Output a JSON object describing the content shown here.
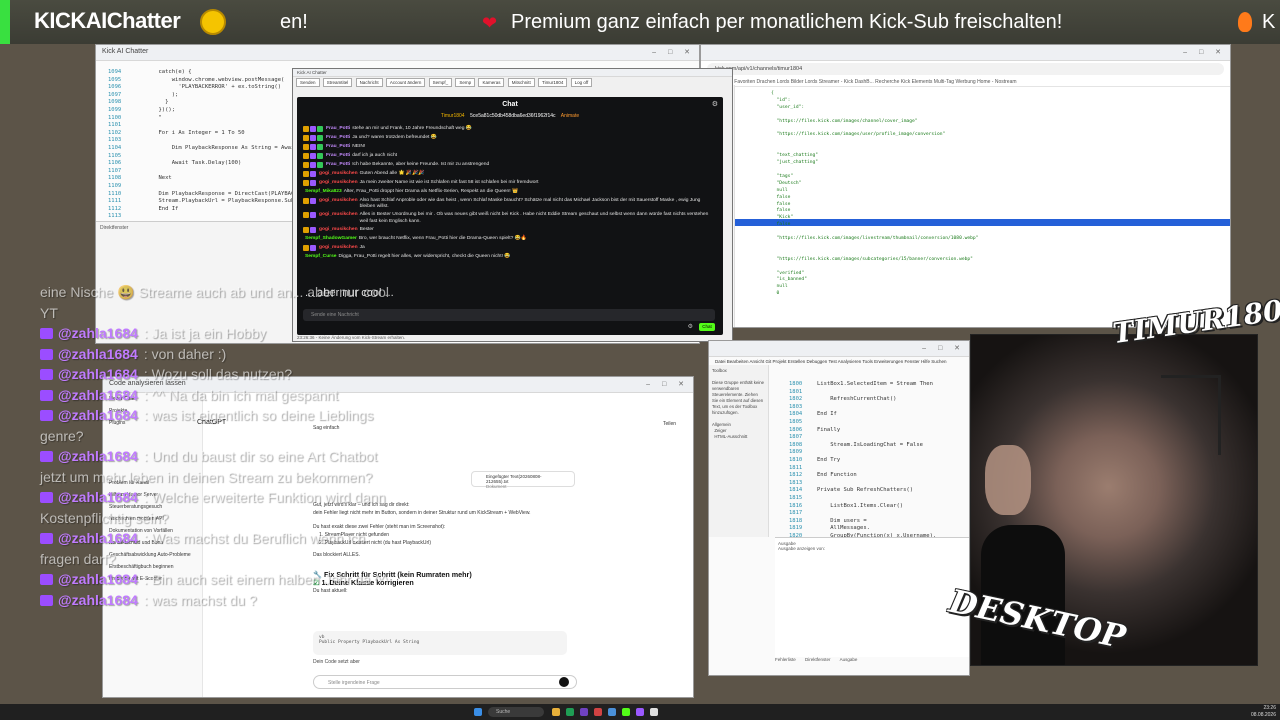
{
  "banner": {
    "logo": "KICKAIChatter",
    "marquee_pre": "en!",
    "marquee": "Premium ganz einfach per monatlichem Kick-Sub freischalten!",
    "marquee_post": "K"
  },
  "vs_topleft": {
    "title": "Kick AI Chatter",
    "gutter": "1094\n1095\n1096\n1097\n1098\n1099\n1100\n1101\n1102\n1103\n1104\n1105\n1106\n1107\n1108\n1109\n1110\n1111\n1112\n1113",
    "code": "        catch(e) {\n            window.chrome.webview.postMessage(\n              'PLAYBACKERROR' + ex.toString()\n            );\n          }\n        })();\n        \"\n\n        For i As Integer = 1 To 50\n\n            Dim PlaybackResponse As String = Await Exe\n\n            Await Task.Delay(100)\n\n        Next\n\n        Dim PlaybackResponse = DirectCast(PLAYBACK)\n        Stream.PlaybackUrl = PlaybackResponse.Substring(9)\n        End If\n\n    End Function",
    "output_label": "Direktfenster"
  },
  "browser_topright": {
    "url": "kick.com/api/v1/channels/timur1804",
    "bookmarks": "Importierte Favoriten   Drachen Lords   Bilder Lords   Streamer - Kick DashB...   Recherche   Kick Elements   Multi-Tag Werbung   Home - Nostream",
    "json_text": "{\n  \"id\":\n  \"user_id\":\n\n  \"https://files.kick.com/images/channel/cover_image\"\n\n  \"https://files.kick.com/images/user/profile_image/conversion\"\n\n\n  \"text_chatting\"\n  \"just_chatting\"\n\n  \"tags\"\n  \"Deutsch\"\n  null\n  false\n  false\n  false\n  \"Kick\"\n  false\n\n  \"https://files.kick.com/images/livestream/thumbnail/conversion/1080.webp\"\n\n\n  \"https://files.kick.com/images/subcategories/15/banner/conversion.webp\"\n\n  \"verified\"\n  \"is_banned\"\n  null\n  0"
  },
  "kick_app": {
    "title": "Kick AI Chatter",
    "toolbar_items": [
      "Senden",
      "Streamtitel",
      "Nachricht",
      "Account ändern",
      "Sempf_",
      "Semp",
      "Kameras",
      "Mitschnitt",
      "Timur1804",
      "Log off"
    ],
    "status": "23:26:36 - Keine Änderung vom Kick-Stream erhalten.",
    "chat": {
      "title": "Chat",
      "stat_1": "Timur1804",
      "stat_2": "5ce5a81c50db458dba6ed36f1962f14c",
      "stat_3": "Animate",
      "input_placeholder": "Sende eine Nachricht",
      "send_label": "Chat",
      "overlay_text": "... aber nur cool ...",
      "messages": [
        {
          "user": "Frau_Potti",
          "color": "#c58bff",
          "badges": 3,
          "text": "stehe an mir und Frank, 10 Jahre Freundschaft weg 😂"
        },
        {
          "user": "Frau_Potti",
          "color": "#c58bff",
          "badges": 3,
          "text": "Ja und? waren trotzdem befreundet 😂"
        },
        {
          "user": "Frau_Potti",
          "color": "#c58bff",
          "badges": 3,
          "text": "NEIN!"
        },
        {
          "user": "Frau_Potti",
          "color": "#c58bff",
          "badges": 3,
          "text": "darf ich ja auch nicht"
        },
        {
          "user": "Frau_Potti",
          "color": "#c58bff",
          "badges": 3,
          "text": "Ich habe Bekannte, aber keine Freunde. Ist mir zu anstrengend"
        },
        {
          "user": "gogi_musikchen",
          "color": "#ff4a4a",
          "badges": 2,
          "text": "Guten Abend alle 🌟 🎉🎉🎉"
        },
        {
          "user": "gogi_musikchen",
          "color": "#ff4a4a",
          "badges": 2,
          "text": "Ja mein zweiter Name ist wie ist Schlafen mit fast 58 ist schlafen bei mir fremdwort"
        },
        {
          "user": "Sempf_Mika823",
          "color": "#53fc18",
          "badges": 0,
          "text": "Alter, Frau_Potti droppt hier Drama als Netflix-Serien, Respekt an die Queen! 👑"
        },
        {
          "user": "gogi_musikchen",
          "color": "#ff4a4a",
          "badges": 2,
          "text": "Also hast Schlaf Anproble oder wie das heist , wenn Schlaf Maske braucht? Schätze mal nicht das Michael Jackson bist der mit Sauerstoff Maske , ewig Jung bleiben willst."
        },
        {
          "user": "gogi_musikchen",
          "color": "#ff4a4a",
          "badges": 2,
          "text": "Alles in Bester Unordnung bei mir . Ob was neues gibt weiß nicht bei Kick . Habe nicht Eddie Stream geschaut und selbst wenn dann würde fast nichts verstehen weil fast kein Englisch kann."
        },
        {
          "user": "gogi_musikchen",
          "color": "#ff4a4a",
          "badges": 2,
          "text": "Bester"
        },
        {
          "user": "Sempf_ShadowGamer",
          "color": "#53fc18",
          "badges": 0,
          "text": "Bro, wer braucht Netflix, wenn Frau_Potti hier die Drama-Queen spielt? 😂🔥"
        },
        {
          "user": "gogi_musikchen",
          "color": "#ff4a4a",
          "badges": 2,
          "text": "Ja"
        },
        {
          "user": "Sempf_Curse",
          "color": "#53fc18",
          "badges": 0,
          "text": "Digga, Frau_Potti regelt hier alles, wer widerspricht, checkt die Queen nicht! 😂"
        }
      ]
    }
  },
  "chatgpt": {
    "title": "Code analysieren lassen",
    "brand": "ChatGPT",
    "sidebar_items": [
      "Neuer Chat",
      "Projekte",
      "Plugins",
      "Problem für Kanal",
      "Hilfe zu Humor Server",
      "Steuerberatungsgesuch",
      "Nachrichten mobilen API",
      "Dokumentation von Vorfällen",
      "Kontaktschuld und Bonn",
      "Geschäftsabwicklung Auto-Probleme",
      "Erstbeschäftigbuch beginnen",
      "Probleme mit E-Scooter"
    ],
    "greeting": "Sag einfach",
    "share": "Teilen",
    "attachment": "Eingefügter Text(20260808-212655).txt",
    "attachment_sub": "Dokument",
    "para1": "Gut, jetzt wird's klar – und ich sag dir direkt:",
    "para2": "dein Fehler liegt nicht mehr im Button, sondern in deiner Struktur rund um KickStream + WebView.",
    "para3": "Du hast exakt diese zwei Fehler (steht man im Screenshot):",
    "item1": "StreamPlayer nicht gefunden",
    "item2": "PlaybackUrl existiert nicht (du hast PlaybackUrl)",
    "para4": "Das blockiert ALLES.",
    "h_fix": "Fix Schritt für Schritt (kein Rumraten mehr)",
    "h_class": "1. Deine Klasse korrigieren",
    "para5": "Du hast aktuell:",
    "code_lang": "vb",
    "code_line": "Public Property PlaybackUrl As String",
    "para6": "Dein Code setzt aber",
    "input_placeholder": "Stelle irgendeine Frage"
  },
  "vs_bottomright": {
    "menu": "Datei  Bearbeiten  Ansicht  Git  Projekt  Erstellen  Debuggen  Test  Analysieren  Tools  Erweiterungen  Fenster  Hilfe  Suchen",
    "toolbox": "Toolbox\n\nDiese Gruppe enthält keine verwendbaren Steuerelemente. Ziehen Sie ein Element auf diesen Text, um es der Toolbox hinzuzufügen.\n\nAllgemein\n  Zeiger\n  HTML-Ausschnitt",
    "gutter": "1800\n1801\n1802\n1803\n1804\n1805\n1806\n1807\n1808\n1809\n1810\n1811\n1812\n1813\n1814\n1815\n1816\n1817\n1818\n1819\n1820\n1821\n1822\n1823",
    "code": "ListBox1.SelectedItem = Stream Then\n\n    RefreshCurrentChat()\n\nEnd If\n\nFinally\n\n    Stream.IsLoadingChat = False\n\nEnd Try\n\nEnd Function\n\nPrivate Sub RefreshChatters()\n\n    ListBox1.Items.Clear()\n\n    Dim users =\n    AllMessages.\n    GroupBy(Function(x) x.Username).\n    OrderBy(Function(x) x.Key)\n\n    For Each user In users\n\n        ListBox1.Items.Add(",
    "output_title": "Ausgabe",
    "output_sub": "Ausgabe anzeigen von:",
    "tabs": [
      "Fehlerliste",
      "Direktfenster",
      "Ausgabe"
    ]
  },
  "webcam": {
    "label_top": "TIMUR1804",
    "label_bottom": "DESKTOP"
  },
  "overlay_chat": [
    {
      "user": "",
      "text": "eine Nische 😃 Streame auch ab und an... aber nur cool"
    },
    {
      "user": "",
      "text": "YT"
    },
    {
      "user": "@zahla1684",
      "text": ": Ja ist ja ein Hobby"
    },
    {
      "user": "@zahla1684",
      "text": ": von daher :)"
    },
    {
      "user": "@zahla1684",
      "text": ": Wozu soll das nutzen?"
    },
    {
      "user": "@zahla1684",
      "text": ": ^^ Na da bin ich mal gespannt"
    },
    {
      "user": "@zahla1684",
      "text": ": was ist eigentlich so deine Lieblings"
    },
    {
      "user": "",
      "text": "genre?"
    },
    {
      "user": "@zahla1684",
      "text": ": Und du baust dir so eine Art Chatbot"
    },
    {
      "user": "",
      "text": "jetzt um mehr leben in deinen Stream zu bekommen?"
    },
    {
      "user": "@zahla1684",
      "text": ": Welche erweiterte Funktion wird dann"
    },
    {
      "user": "",
      "text": "Kostenpflichtig sein?"
    },
    {
      "user": "@zahla1684",
      "text": ": Was machst du Beruflich wenn ich"
    },
    {
      "user": "",
      "text": "fragen darf?"
    },
    {
      "user": "@zahla1684",
      "text": ": Bin auch seit einem halben Jahr da ^^"
    },
    {
      "user": "@zahla1684",
      "text": ": was machst du ?"
    }
  ],
  "taskbar": {
    "search": "Suche",
    "time": "23:26",
    "date": "08.08.2026"
  }
}
